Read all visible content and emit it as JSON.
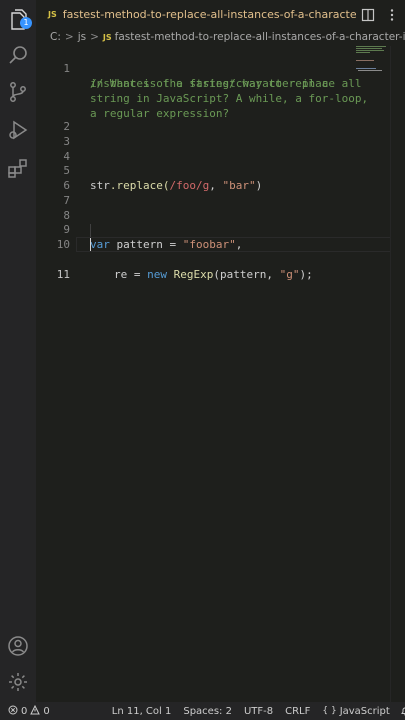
{
  "activity_bar": {
    "items": [
      "files-icon",
      "search-icon",
      "source-control-icon",
      "run-debug-icon",
      "extensions-icon"
    ],
    "badge_count": "1",
    "bottom": [
      "account-icon",
      "manage-gear-icon"
    ]
  },
  "tab": {
    "lang_badge": "JS",
    "title": "fastest-method-to-replace-all-instances-of-a-character-in-a-string"
  },
  "breadcrumb": {
    "drive": "C:",
    "sep": ">",
    "folder": "js",
    "lang_badge": "JS",
    "file": "fastest-method-to-replace-all-instances-of-a-character-in..."
  },
  "editor": {
    "line_numbers": [
      "1",
      "2",
      "3",
      "4",
      "5",
      "6",
      "7",
      "8",
      "9",
      "10",
      "11"
    ],
    "comment": [
      "// What is the fastest way to replace all",
      "instances of a string/character in a",
      "string in JavaScript? A while, a for-loop,",
      "a regular expression?"
    ],
    "line5": {
      "obj": "str",
      "method": ".replace(",
      "regex": "/foo/g",
      "sep": ", ",
      "str": "\"bar\"",
      "close": ")"
    },
    "line9": {
      "kw": "var",
      "name": " pattern = ",
      "str": "\"foobar\"",
      "end": ","
    },
    "line10": {
      "name": "re = ",
      "kw": "new",
      "fn": " RegExp",
      "args": "(pattern, ",
      "str": "\"g\"",
      "end": ");"
    }
  },
  "status": {
    "errors": "0",
    "warnings": "0",
    "position": "Ln 11, Col 1",
    "spaces": "Spaces: 2",
    "encoding": "UTF-8",
    "eol": "CRLF",
    "language": "JavaScript"
  }
}
